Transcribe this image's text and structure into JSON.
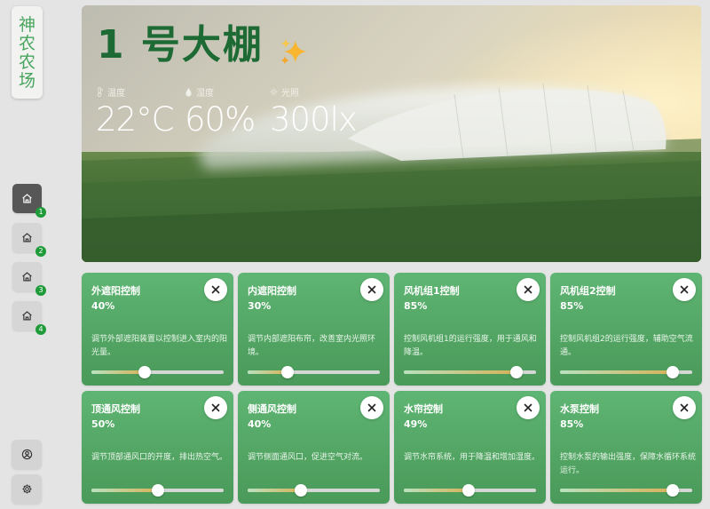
{
  "app": {
    "brand": "神农农场"
  },
  "sidebar": {
    "nav": [
      {
        "badge": "1",
        "icon": "home-icon",
        "active": true
      },
      {
        "badge": "2",
        "icon": "home-icon",
        "active": false
      },
      {
        "badge": "3",
        "icon": "home-icon",
        "active": false
      },
      {
        "badge": "4",
        "icon": "home-icon",
        "active": false
      }
    ],
    "bottom": [
      {
        "icon": "user-icon"
      },
      {
        "icon": "gear-icon"
      }
    ]
  },
  "hero": {
    "title": "1 号大棚",
    "sparkle_icon": "sparkle-icon",
    "metrics": [
      {
        "label": "温度",
        "value": "22°C",
        "icon": "thermometer-icon"
      },
      {
        "label": "湿度",
        "value": "60%",
        "icon": "droplet-icon"
      },
      {
        "label": "光照",
        "value": "300lx",
        "icon": "sun-icon"
      }
    ]
  },
  "controls": [
    {
      "title": "外遮阳控制",
      "value": "40%",
      "level": 0.4,
      "desc": "调节外部遮阳装置以控制进入室内的阳光量。"
    },
    {
      "title": "内遮阳控制",
      "value": "30%",
      "level": 0.3,
      "desc": "调节内部遮阳布帘，改善室内光照环境。"
    },
    {
      "title": "风机组1控制",
      "value": "85%",
      "level": 0.85,
      "desc": "控制风机组1的运行强度，用于通风和降温。"
    },
    {
      "title": "风机组2控制",
      "value": "85%",
      "level": 0.85,
      "desc": "控制风机组2的运行强度，辅助空气流通。"
    },
    {
      "title": "顶通风控制",
      "value": "50%",
      "level": 0.5,
      "desc": "调节顶部通风口的开度，排出热空气。"
    },
    {
      "title": "侧通风控制",
      "value": "40%",
      "level": 0.4,
      "desc": "调节侧面通风口，促进空气对流。"
    },
    {
      "title": "水帘控制",
      "value": "49%",
      "level": 0.49,
      "desc": "调节水帘系统，用于降温和增加湿度。"
    },
    {
      "title": "水泵控制",
      "value": "85%",
      "level": 0.85,
      "desc": "控制水泵的输出强度，保障水循环系统运行。"
    }
  ],
  "colors": {
    "brand_green": "#48a55e",
    "title_green": "#1d6a34",
    "card_green": "#5fb573",
    "badge_green": "#1f9b3a"
  }
}
